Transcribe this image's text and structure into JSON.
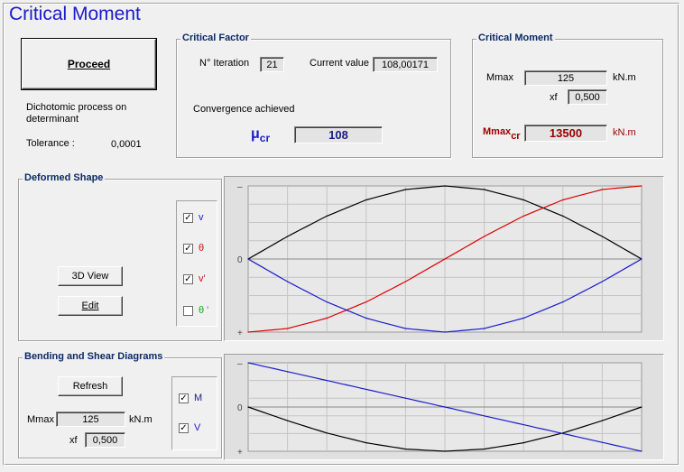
{
  "window": {
    "title": "Critical Moment"
  },
  "proceed": {
    "button_label": "Proceed",
    "method_text": "Dichotomic process on determinant",
    "tolerance_label": "Tolerance :",
    "tolerance_value": "0,0001"
  },
  "critical_factor": {
    "title": "Critical Factor",
    "iteration_label": "N° Iteration",
    "iteration_value": "21",
    "current_label": "Current value",
    "current_value": "108,00171",
    "status": "Convergence achieved",
    "mu_symbol": "μ",
    "mu_sub": "cr",
    "mu_value": "108"
  },
  "critical_moment": {
    "title": "Critical Moment",
    "mmax_label": "Mmax",
    "mmax_value": "125",
    "mmax_unit": "kN.m",
    "xf_label": "xf",
    "xf_value": "0,500",
    "mcr_label": "Mmax",
    "mcr_sub": "cr",
    "mcr_value": "13500",
    "mcr_unit": "kN.m"
  },
  "deformed_shape": {
    "title": "Deformed Shape",
    "view3d_label": "3D View",
    "edit_label": "Edit",
    "checks": [
      {
        "label": "v",
        "checked": true,
        "mark": "✓",
        "color": "#1a1acc"
      },
      {
        "label": "θ",
        "checked": true,
        "mark": "✓",
        "color": "#cc1111"
      },
      {
        "label": "v'",
        "checked": true,
        "mark": "✓",
        "color": "#cc1111"
      },
      {
        "label": "θ '",
        "checked": false,
        "mark": "",
        "color": "#11aa11"
      }
    ]
  },
  "bending": {
    "title": "Bending and Shear Diagrams",
    "refresh_label": "Refresh",
    "mmax_label": "Mmax",
    "mmax_value": "125",
    "unit": "kN.m",
    "xf_label": "xf",
    "xf_value": "0,500",
    "checks": [
      {
        "label": "M",
        "checked": true,
        "mark": "✓",
        "color": "#1a1a88"
      },
      {
        "label": "V",
        "checked": true,
        "mark": "✓",
        "color": "#1a1acc"
      }
    ]
  },
  "chart_data": [
    {
      "type": "line",
      "ticks": {
        "top": "–",
        "middle": "0",
        "bottom": "+"
      },
      "grid": true,
      "x": [
        0,
        0.1,
        0.2,
        0.3,
        0.4,
        0.5,
        0.6,
        0.7,
        0.8,
        0.9,
        1.0
      ],
      "ylim": [
        -1,
        1
      ],
      "series": [
        {
          "color": "#000000",
          "values": [
            0,
            0.309,
            0.588,
            0.809,
            0.951,
            1.0,
            0.951,
            0.809,
            0.588,
            0.309,
            0
          ]
        },
        {
          "color": "#dd0000",
          "values": [
            -1,
            -0.951,
            -0.809,
            -0.588,
            -0.309,
            0,
            0.309,
            0.588,
            0.809,
            0.951,
            1.0
          ]
        },
        {
          "color": "#1a1acc",
          "values": [
            0,
            -0.309,
            -0.588,
            -0.809,
            -0.951,
            -1.0,
            -0.951,
            -0.809,
            -0.588,
            -0.309,
            0
          ]
        }
      ]
    },
    {
      "type": "line",
      "ticks": {
        "top": "–",
        "middle": "0",
        "bottom": "+"
      },
      "grid": true,
      "x": [
        0,
        0.1,
        0.2,
        0.3,
        0.4,
        0.5,
        0.6,
        0.7,
        0.8,
        0.9,
        1.0
      ],
      "ylim": [
        -1,
        1
      ],
      "series": [
        {
          "color": "#000000",
          "values": [
            0,
            -0.309,
            -0.588,
            -0.809,
            -0.951,
            -1.0,
            -0.951,
            -0.809,
            -0.588,
            -0.309,
            0
          ]
        },
        {
          "color": "#1a1acc",
          "values": [
            1.0,
            0.8,
            0.6,
            0.4,
            0.2,
            0,
            -0.2,
            -0.4,
            -0.6,
            -0.8,
            -1.0
          ]
        }
      ]
    }
  ]
}
